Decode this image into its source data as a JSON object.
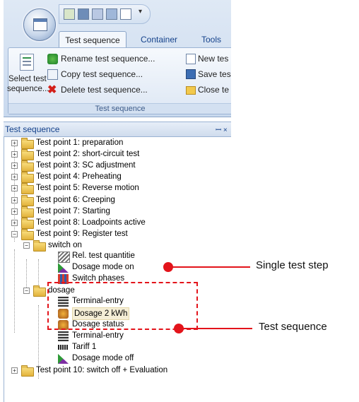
{
  "ribbon": {
    "tabs": [
      "Test sequence",
      "Container",
      "Tools"
    ],
    "active_tab": "Test sequence",
    "select_button": {
      "line1": "Select test",
      "line2": "sequence..."
    },
    "col1": [
      "Rename test sequence...",
      "Copy test sequence...",
      "Delete test sequence..."
    ],
    "col2": [
      "New tes",
      "Save tes",
      "Close te"
    ],
    "group_label": "Test sequence",
    "qat_dropdown": "▾"
  },
  "pane": {
    "title": "Test sequence",
    "pin_glyph": "ꟷ ×"
  },
  "tree": {
    "test_points": [
      "Test point 1: preparation",
      "Test point 2: short-circuit test",
      "Test point 3: SC adjustment",
      "Test point 4: Preheating",
      "Test point 5: Reverse motion",
      "Test point 6: Creeping",
      "Test point 7: Starting",
      "Test point 8: Loadpoints active",
      "Test point 9: Register test"
    ],
    "group1": {
      "label": "switch on",
      "steps": [
        "Rel. test quantitie",
        "Dosage mode on",
        "Switch phases"
      ]
    },
    "group2": {
      "label": "dosage",
      "steps": [
        "Terminal-entry",
        "Dosage 2 kWh",
        "Dosage status",
        "Terminal-entry",
        "Tariff 1",
        "Dosage mode off"
      ]
    },
    "last_point": "Test point 10: switch off + Evaluation"
  },
  "annotations": {
    "single_step": "Single test step",
    "sequence": "Test sequence",
    "color": "#e3141b"
  }
}
